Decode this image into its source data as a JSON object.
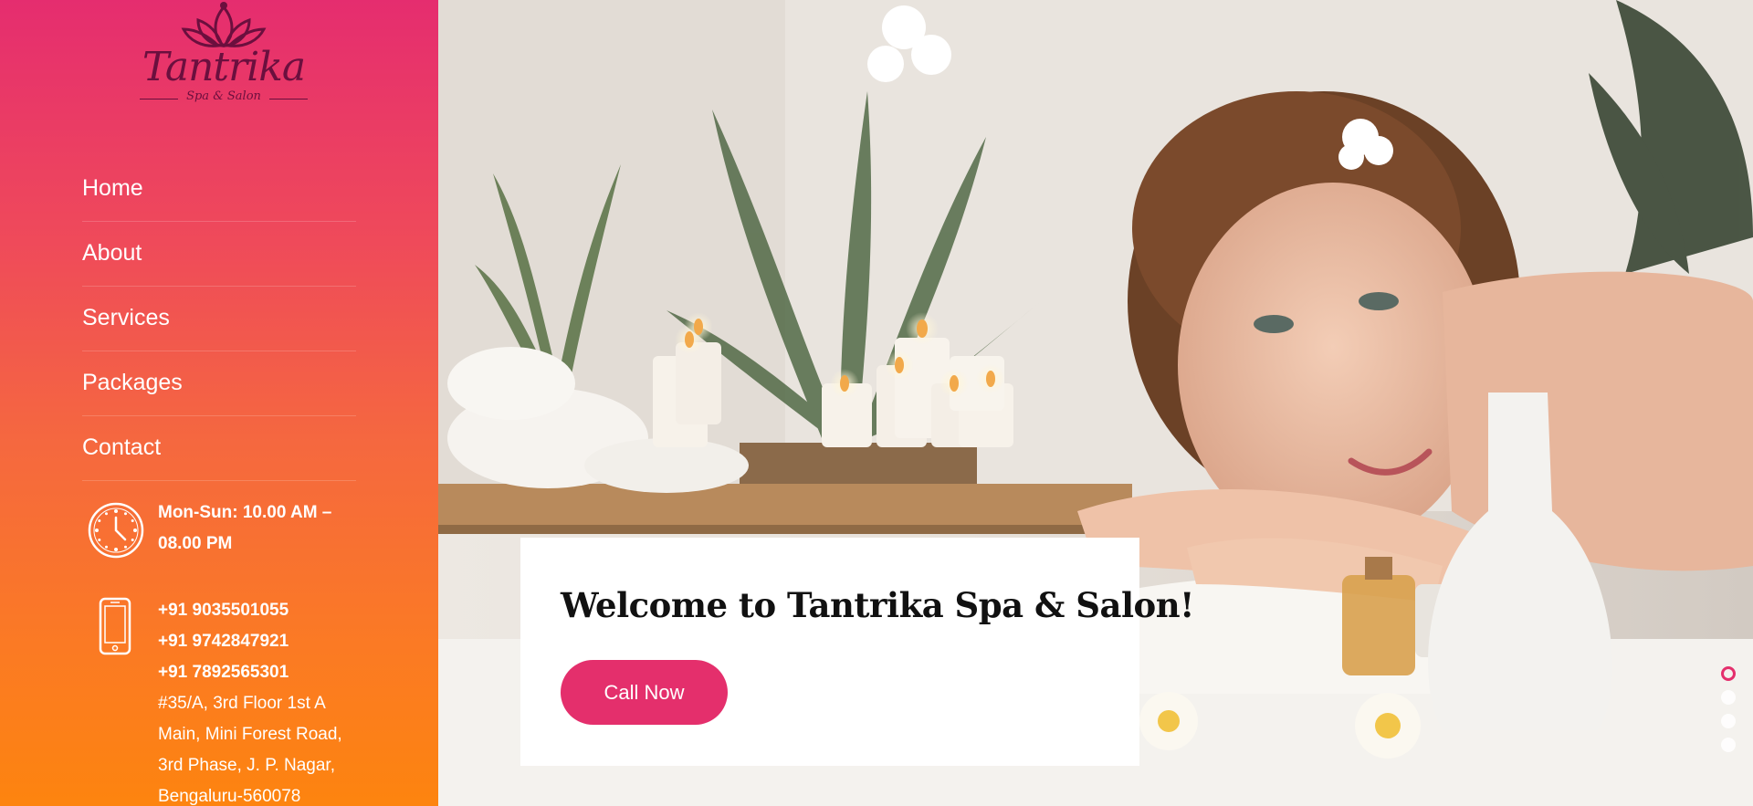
{
  "brand": {
    "name": "Tantrika",
    "tagline": "Spa & Salon"
  },
  "nav": {
    "items": [
      {
        "label": "Home"
      },
      {
        "label": "About"
      },
      {
        "label": "Services"
      },
      {
        "label": "Packages"
      },
      {
        "label": "Contact"
      }
    ]
  },
  "info": {
    "hours_line1": "Mon-Sun: 10.00 AM –",
    "hours_line2": "08.00 PM",
    "phones": [
      "+91 9035501055",
      "+91 9742847921",
      "+91 7892565301"
    ],
    "address_lines": [
      "#35/A, 3rd Floor 1st A",
      "Main, Mini Forest Road,",
      "3rd Phase, J. P. Nagar,",
      "Bengaluru-560078"
    ]
  },
  "hero": {
    "welcome_title": "Welcome to Tantrika Spa & Salon!",
    "cta_label": "Call Now",
    "slides_count": 4,
    "active_slide": 1
  },
  "colors": {
    "accent": "#e42f6c",
    "gradient_top": "#e52d6f",
    "gradient_bottom": "#fd840f",
    "logo": "#6b0f3e"
  },
  "icons": [
    "lotus-logo-icon",
    "clock-icon",
    "phone-icon"
  ]
}
